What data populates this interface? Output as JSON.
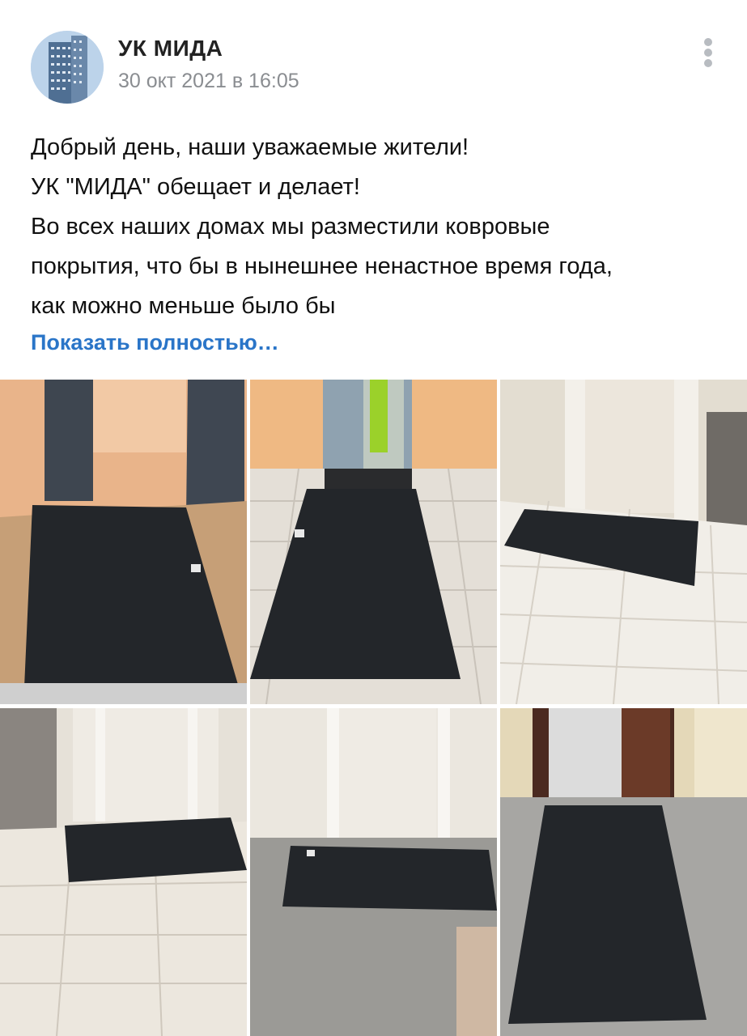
{
  "post": {
    "author": "УК МИДА",
    "timestamp": "30 окт 2021 в 16:05",
    "text_lines": [
      "Добрый день, наши уважаемые жители!",
      "УК \"МИДА\" обещает и делает!",
      "Во всех наших домах мы разместили ковровые",
      "покрытия, что бы в нынешнее ненастное время года,",
      "как можно меньше было бы"
    ],
    "show_more": "Показать полностью…"
  },
  "photos_count": 6,
  "colors": {
    "accent": "#2a75c8",
    "meta_gray": "#8a8d91",
    "mat": "#1f2226"
  }
}
